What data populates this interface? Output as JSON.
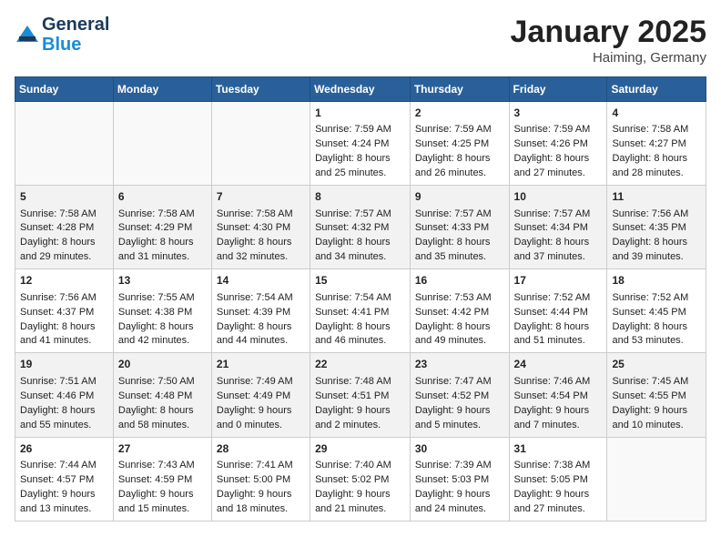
{
  "header": {
    "logo_line1": "General",
    "logo_line2": "Blue",
    "month": "January 2025",
    "location": "Haiming, Germany"
  },
  "days_of_week": [
    "Sunday",
    "Monday",
    "Tuesday",
    "Wednesday",
    "Thursday",
    "Friday",
    "Saturday"
  ],
  "weeks": [
    [
      {
        "day": "",
        "content": ""
      },
      {
        "day": "",
        "content": ""
      },
      {
        "day": "",
        "content": ""
      },
      {
        "day": "1",
        "content": "Sunrise: 7:59 AM\nSunset: 4:24 PM\nDaylight: 8 hours\nand 25 minutes."
      },
      {
        "day": "2",
        "content": "Sunrise: 7:59 AM\nSunset: 4:25 PM\nDaylight: 8 hours\nand 26 minutes."
      },
      {
        "day": "3",
        "content": "Sunrise: 7:59 AM\nSunset: 4:26 PM\nDaylight: 8 hours\nand 27 minutes."
      },
      {
        "day": "4",
        "content": "Sunrise: 7:58 AM\nSunset: 4:27 PM\nDaylight: 8 hours\nand 28 minutes."
      }
    ],
    [
      {
        "day": "5",
        "content": "Sunrise: 7:58 AM\nSunset: 4:28 PM\nDaylight: 8 hours\nand 29 minutes."
      },
      {
        "day": "6",
        "content": "Sunrise: 7:58 AM\nSunset: 4:29 PM\nDaylight: 8 hours\nand 31 minutes."
      },
      {
        "day": "7",
        "content": "Sunrise: 7:58 AM\nSunset: 4:30 PM\nDaylight: 8 hours\nand 32 minutes."
      },
      {
        "day": "8",
        "content": "Sunrise: 7:57 AM\nSunset: 4:32 PM\nDaylight: 8 hours\nand 34 minutes."
      },
      {
        "day": "9",
        "content": "Sunrise: 7:57 AM\nSunset: 4:33 PM\nDaylight: 8 hours\nand 35 minutes."
      },
      {
        "day": "10",
        "content": "Sunrise: 7:57 AM\nSunset: 4:34 PM\nDaylight: 8 hours\nand 37 minutes."
      },
      {
        "day": "11",
        "content": "Sunrise: 7:56 AM\nSunset: 4:35 PM\nDaylight: 8 hours\nand 39 minutes."
      }
    ],
    [
      {
        "day": "12",
        "content": "Sunrise: 7:56 AM\nSunset: 4:37 PM\nDaylight: 8 hours\nand 41 minutes."
      },
      {
        "day": "13",
        "content": "Sunrise: 7:55 AM\nSunset: 4:38 PM\nDaylight: 8 hours\nand 42 minutes."
      },
      {
        "day": "14",
        "content": "Sunrise: 7:54 AM\nSunset: 4:39 PM\nDaylight: 8 hours\nand 44 minutes."
      },
      {
        "day": "15",
        "content": "Sunrise: 7:54 AM\nSunset: 4:41 PM\nDaylight: 8 hours\nand 46 minutes."
      },
      {
        "day": "16",
        "content": "Sunrise: 7:53 AM\nSunset: 4:42 PM\nDaylight: 8 hours\nand 49 minutes."
      },
      {
        "day": "17",
        "content": "Sunrise: 7:52 AM\nSunset: 4:44 PM\nDaylight: 8 hours\nand 51 minutes."
      },
      {
        "day": "18",
        "content": "Sunrise: 7:52 AM\nSunset: 4:45 PM\nDaylight: 8 hours\nand 53 minutes."
      }
    ],
    [
      {
        "day": "19",
        "content": "Sunrise: 7:51 AM\nSunset: 4:46 PM\nDaylight: 8 hours\nand 55 minutes."
      },
      {
        "day": "20",
        "content": "Sunrise: 7:50 AM\nSunset: 4:48 PM\nDaylight: 8 hours\nand 58 minutes."
      },
      {
        "day": "21",
        "content": "Sunrise: 7:49 AM\nSunset: 4:49 PM\nDaylight: 9 hours\nand 0 minutes."
      },
      {
        "day": "22",
        "content": "Sunrise: 7:48 AM\nSunset: 4:51 PM\nDaylight: 9 hours\nand 2 minutes."
      },
      {
        "day": "23",
        "content": "Sunrise: 7:47 AM\nSunset: 4:52 PM\nDaylight: 9 hours\nand 5 minutes."
      },
      {
        "day": "24",
        "content": "Sunrise: 7:46 AM\nSunset: 4:54 PM\nDaylight: 9 hours\nand 7 minutes."
      },
      {
        "day": "25",
        "content": "Sunrise: 7:45 AM\nSunset: 4:55 PM\nDaylight: 9 hours\nand 10 minutes."
      }
    ],
    [
      {
        "day": "26",
        "content": "Sunrise: 7:44 AM\nSunset: 4:57 PM\nDaylight: 9 hours\nand 13 minutes."
      },
      {
        "day": "27",
        "content": "Sunrise: 7:43 AM\nSunset: 4:59 PM\nDaylight: 9 hours\nand 15 minutes."
      },
      {
        "day": "28",
        "content": "Sunrise: 7:41 AM\nSunset: 5:00 PM\nDaylight: 9 hours\nand 18 minutes."
      },
      {
        "day": "29",
        "content": "Sunrise: 7:40 AM\nSunset: 5:02 PM\nDaylight: 9 hours\nand 21 minutes."
      },
      {
        "day": "30",
        "content": "Sunrise: 7:39 AM\nSunset: 5:03 PM\nDaylight: 9 hours\nand 24 minutes."
      },
      {
        "day": "31",
        "content": "Sunrise: 7:38 AM\nSunset: 5:05 PM\nDaylight: 9 hours\nand 27 minutes."
      },
      {
        "day": "",
        "content": ""
      }
    ]
  ]
}
